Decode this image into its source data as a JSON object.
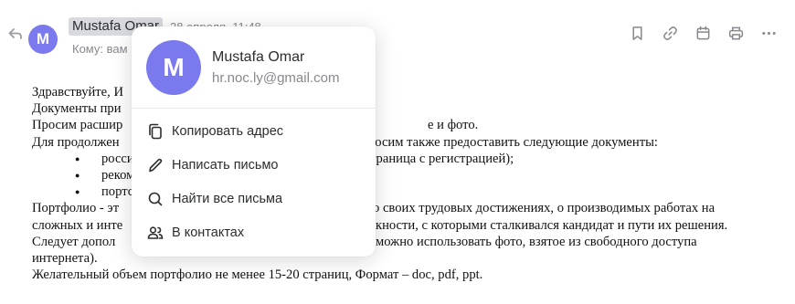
{
  "header": {
    "sender_name": "Mustafa Omar",
    "avatar_letter": "M",
    "date": "28 апреля, 11:48",
    "to_label": "Кому: вам"
  },
  "toolbar": {
    "icons": [
      "bookmark-icon",
      "link-icon",
      "calendar-icon",
      "printer-icon",
      "more-icon"
    ]
  },
  "letter": {
    "greeting": "Здравствуйте, И",
    "line2": "Документы при",
    "line3_left": "Просим расшир",
    "line3_right": "е и фото.",
    "line4_left": "Для продолжен",
    "line4_right": "росим также предоставить следующие документы:",
    "bullets": [
      {
        "left": "росси",
        "right": "траница с регистрацией);"
      },
      {
        "left": "реком",
        "right": ""
      },
      {
        "left": "портс",
        "right": ""
      }
    ],
    "para_line1_left": "Портфолио - эт",
    "para_line1_right": "о своих трудовых достижениях, о производимых работах на",
    "para_line2_left": "сложных и инте",
    "para_line2_right": "кности, с которыми сталкивался кандидат и пути их решения.",
    "para_line3_left": "Следует допол",
    "para_line3_right": "можно использовать фото, взятое из свободного доступа",
    "para_line4": "интернета).",
    "last_line": "Желательный объем портфолио не менее 15-20 страниц, Формат – doc, pdf, ppt."
  },
  "popover": {
    "avatar_letter": "M",
    "name": "Mustafa Omar",
    "email": "hr.noc.ly@gmail.com",
    "menu": [
      {
        "label": "Копировать адрес",
        "icon": "copy-icon"
      },
      {
        "label": "Написать письмо",
        "icon": "pencil-icon"
      },
      {
        "label": "Найти все письма",
        "icon": "search-icon"
      },
      {
        "label": "В контактах",
        "icon": "contacts-icon"
      }
    ]
  },
  "colors": {
    "avatar": "#7b79ee",
    "sender_highlight": "#d8dae0",
    "muted_text": "#87898f"
  }
}
